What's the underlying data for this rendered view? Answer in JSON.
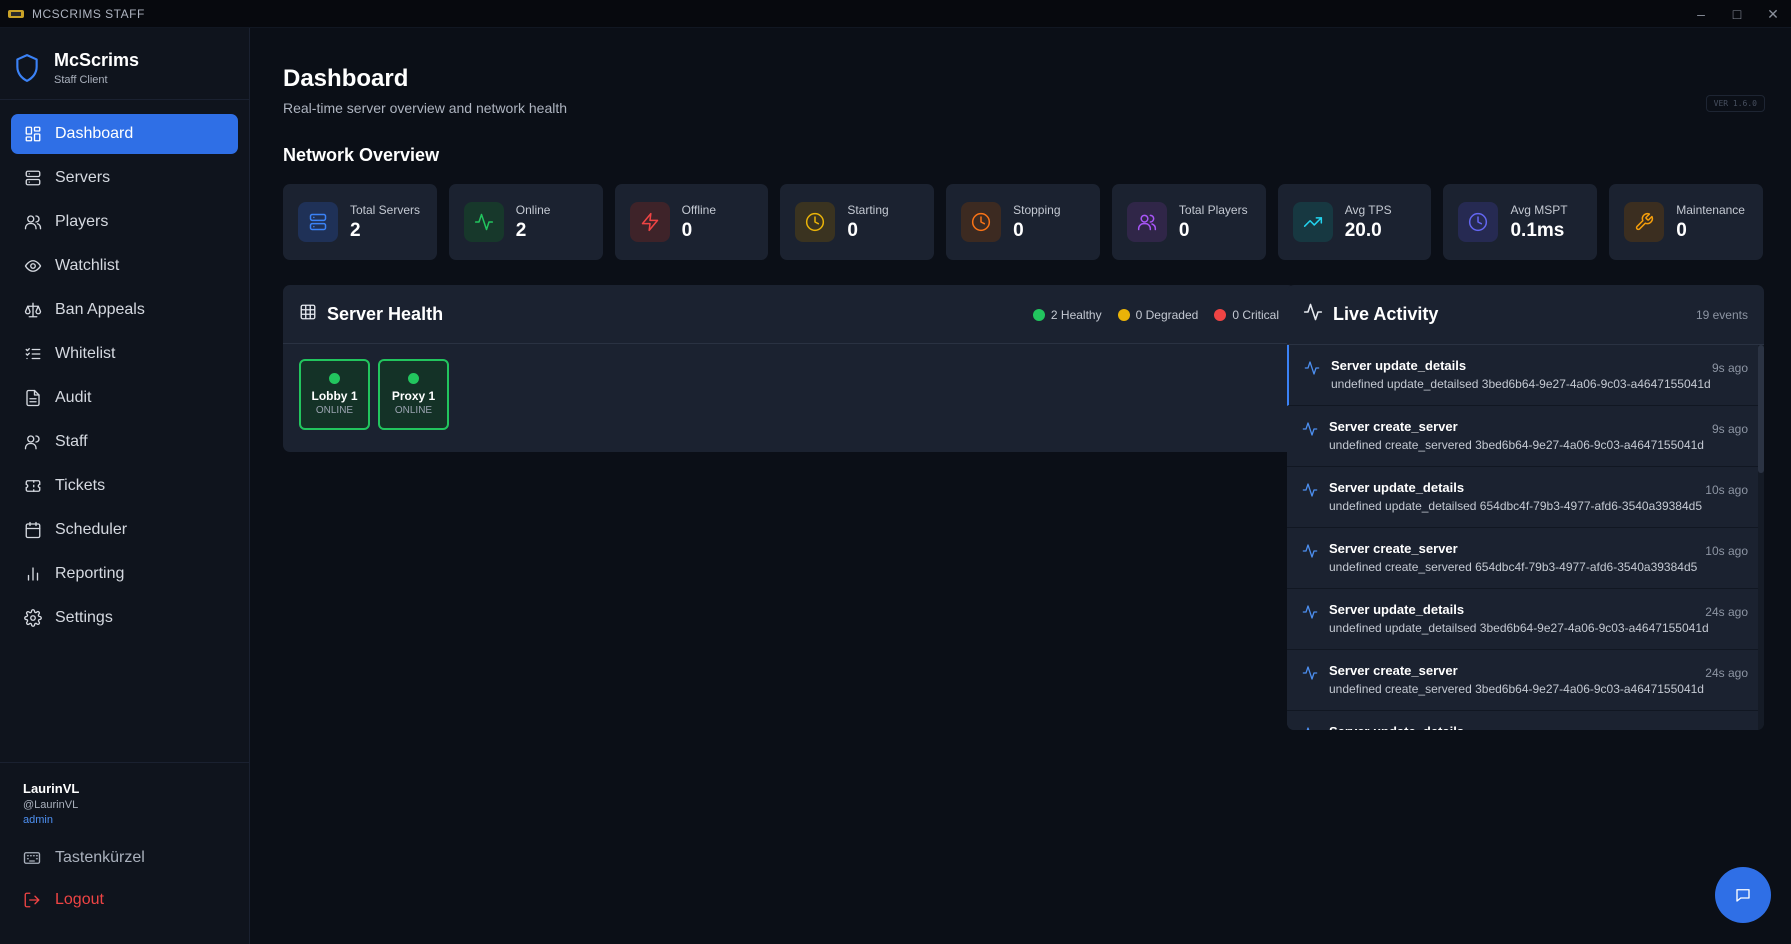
{
  "window": {
    "title": "MCSCRIMS STAFF"
  },
  "brand": {
    "name": "McScrims",
    "sub": "Staff Client"
  },
  "nav": [
    {
      "label": "Dashboard",
      "icon": "grid-icon",
      "active": true
    },
    {
      "label": "Servers",
      "icon": "server-icon"
    },
    {
      "label": "Players",
      "icon": "users-icon"
    },
    {
      "label": "Watchlist",
      "icon": "eye-icon"
    },
    {
      "label": "Ban Appeals",
      "icon": "scale-icon"
    },
    {
      "label": "Whitelist",
      "icon": "list-check-icon"
    },
    {
      "label": "Audit",
      "icon": "file-icon"
    },
    {
      "label": "Staff",
      "icon": "staff-icon"
    },
    {
      "label": "Tickets",
      "icon": "ticket-icon"
    },
    {
      "label": "Scheduler",
      "icon": "calendar-icon"
    },
    {
      "label": "Reporting",
      "icon": "bar-chart-icon"
    },
    {
      "label": "Settings",
      "icon": "gear-icon"
    }
  ],
  "user": {
    "name": "LaurinVL",
    "handle": "@LaurinVL",
    "role": "admin"
  },
  "sidebar_footer": {
    "shortcuts": "Tastenkürzel",
    "logout": "Logout"
  },
  "page": {
    "title": "Dashboard",
    "subtitle": "Real-time server overview and network health",
    "version": "VER 1.6.0"
  },
  "overview": {
    "title": "Network Overview",
    "stats": [
      {
        "label": "Total Servers",
        "value": "2",
        "icon": "server-icon",
        "color": "#3b82f6",
        "bg": "#1f3157"
      },
      {
        "label": "Online",
        "value": "2",
        "icon": "activity-icon",
        "color": "#22c55e",
        "bg": "#17382b"
      },
      {
        "label": "Offline",
        "value": "0",
        "icon": "lightning-icon",
        "color": "#ef4444",
        "bg": "#3e2329"
      },
      {
        "label": "Starting",
        "value": "0",
        "icon": "clock-icon",
        "color": "#eab308",
        "bg": "#3a3320"
      },
      {
        "label": "Stopping",
        "value": "0",
        "icon": "clock-icon",
        "color": "#f97316",
        "bg": "#3c2a21"
      },
      {
        "label": "Total Players",
        "value": "0",
        "icon": "users-icon",
        "color": "#a855f7",
        "bg": "#302648"
      },
      {
        "label": "Avg TPS",
        "value": "20.0",
        "icon": "trending-up-icon",
        "color": "#22d3ee",
        "bg": "#173841"
      },
      {
        "label": "Avg MSPT",
        "value": "0.1ms",
        "icon": "clock-icon",
        "color": "#6366f1",
        "bg": "#262a52"
      },
      {
        "label": "Maintenance",
        "value": "0",
        "icon": "wrench-icon",
        "color": "#f59e0b",
        "bg": "#3b2e20"
      }
    ]
  },
  "health": {
    "title": "Server Health",
    "legend": [
      {
        "label": "2 Healthy",
        "color": "#22c55e"
      },
      {
        "label": "0 Degraded",
        "color": "#eab308"
      },
      {
        "label": "0 Critical",
        "color": "#ef4444"
      }
    ],
    "servers": [
      {
        "name": "Lobby 1",
        "status": "ONLINE"
      },
      {
        "name": "Proxy 1",
        "status": "ONLINE"
      }
    ]
  },
  "activity": {
    "title": "Live Activity",
    "count": "19 events",
    "events": [
      {
        "title": "Server update_details",
        "desc": "undefined update_detailsed 3bed6b64-9e27-4a06-9c03-a4647155041d",
        "time": "9s ago"
      },
      {
        "title": "Server create_server",
        "desc": "undefined create_servered 3bed6b64-9e27-4a06-9c03-a4647155041d",
        "time": "9s ago"
      },
      {
        "title": "Server update_details",
        "desc": "undefined update_detailsed 654dbc4f-79b3-4977-afd6-3540a39384d5",
        "time": "10s ago"
      },
      {
        "title": "Server create_server",
        "desc": "undefined create_servered 654dbc4f-79b3-4977-afd6-3540a39384d5",
        "time": "10s ago"
      },
      {
        "title": "Server update_details",
        "desc": "undefined update_detailsed 3bed6b64-9e27-4a06-9c03-a4647155041d",
        "time": "24s ago"
      },
      {
        "title": "Server create_server",
        "desc": "undefined create_servered 3bed6b64-9e27-4a06-9c03-a4647155041d",
        "time": "24s ago"
      },
      {
        "title": "Server update_details",
        "desc": "",
        "time": ""
      }
    ]
  }
}
